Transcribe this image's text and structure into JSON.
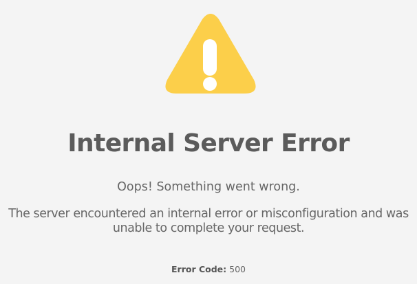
{
  "icon": {
    "name": "warning-triangle-icon",
    "color": "#fccf4a",
    "symbol_color": "#ffffff"
  },
  "title": "Internal Server Error",
  "message": {
    "headline": "Oops! Something went wrong.",
    "line1": "The server encountered an internal error or misconfiguration and was",
    "line2": "unable to complete your request."
  },
  "error": {
    "label": "Error Code:",
    "value": "500"
  }
}
